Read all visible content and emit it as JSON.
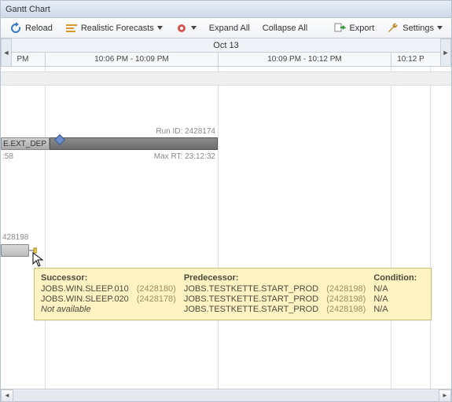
{
  "window": {
    "title": "Gantt Chart"
  },
  "toolbar": {
    "reload": "Reload",
    "forecasts": "Realistic Forecasts",
    "expand": "Expand All",
    "collapse": "Collapse All",
    "export": "Export",
    "settings": "Settings"
  },
  "timeline": {
    "date": "Oct 13",
    "cols": [
      "PM",
      "10:06 PM - 10:09 PM",
      "10:09 PM - 10:12 PM",
      "10:12 P"
    ]
  },
  "chart": {
    "run_id_label": "Run ID: 2428174",
    "bar_label": "E.EXT_DEP",
    "time_a": ":58",
    "max_rt": "Max RT: 23:12:32",
    "job_id": "428198"
  },
  "tooltip": {
    "h_succ": "Successor:",
    "h_pred": "Predecessor:",
    "h_cond": "Condition:",
    "rows": [
      {
        "succ_name": "JOBS.WIN.SLEEP.010",
        "succ_id": "(2428180)",
        "pred_name": "JOBS.TESTKETTE.START_PROD",
        "pred_id": "(2428198)",
        "cond": "N/A"
      },
      {
        "succ_name": "JOBS.WIN.SLEEP.020",
        "succ_id": "(2428178)",
        "pred_name": "JOBS.TESTKETTE.START_PROD",
        "pred_id": "(2428198)",
        "cond": "N/A"
      },
      {
        "succ_name": "Not available",
        "succ_id": "",
        "pred_name": "JOBS.TESTKETTE.START_PROD",
        "pred_id": "(2428198)",
        "cond": "N/A",
        "italic": true
      }
    ]
  }
}
